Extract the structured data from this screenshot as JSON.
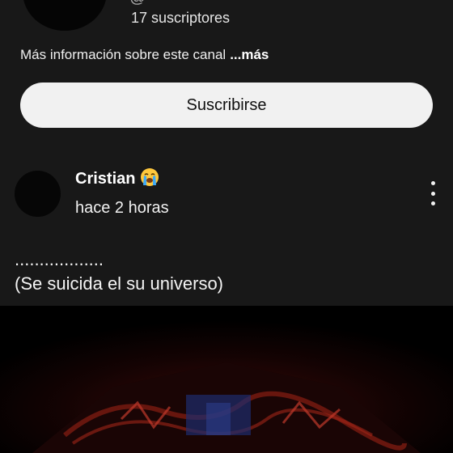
{
  "channel": {
    "handle_fragment": "@",
    "subscribers": "17 suscriptores",
    "more_info": "Más información sobre este canal",
    "more_link": "...más",
    "subscribe_label": "Suscribirse"
  },
  "post": {
    "author": "Cristian",
    "author_emoji": "loudly-crying-face-icon",
    "timestamp": "hace 2 horas",
    "text_line1": "..................",
    "text_line2": "(Se suicida el su universo)",
    "image": {
      "description_colors": [
        "#000000",
        "#2a0606",
        "#8b1a12",
        "#1a2a6a"
      ]
    }
  },
  "colors": {
    "background": "#181818",
    "button_bg": "#f1f1f1",
    "button_text": "#0f0f0f",
    "text": "#f1f1f1"
  }
}
